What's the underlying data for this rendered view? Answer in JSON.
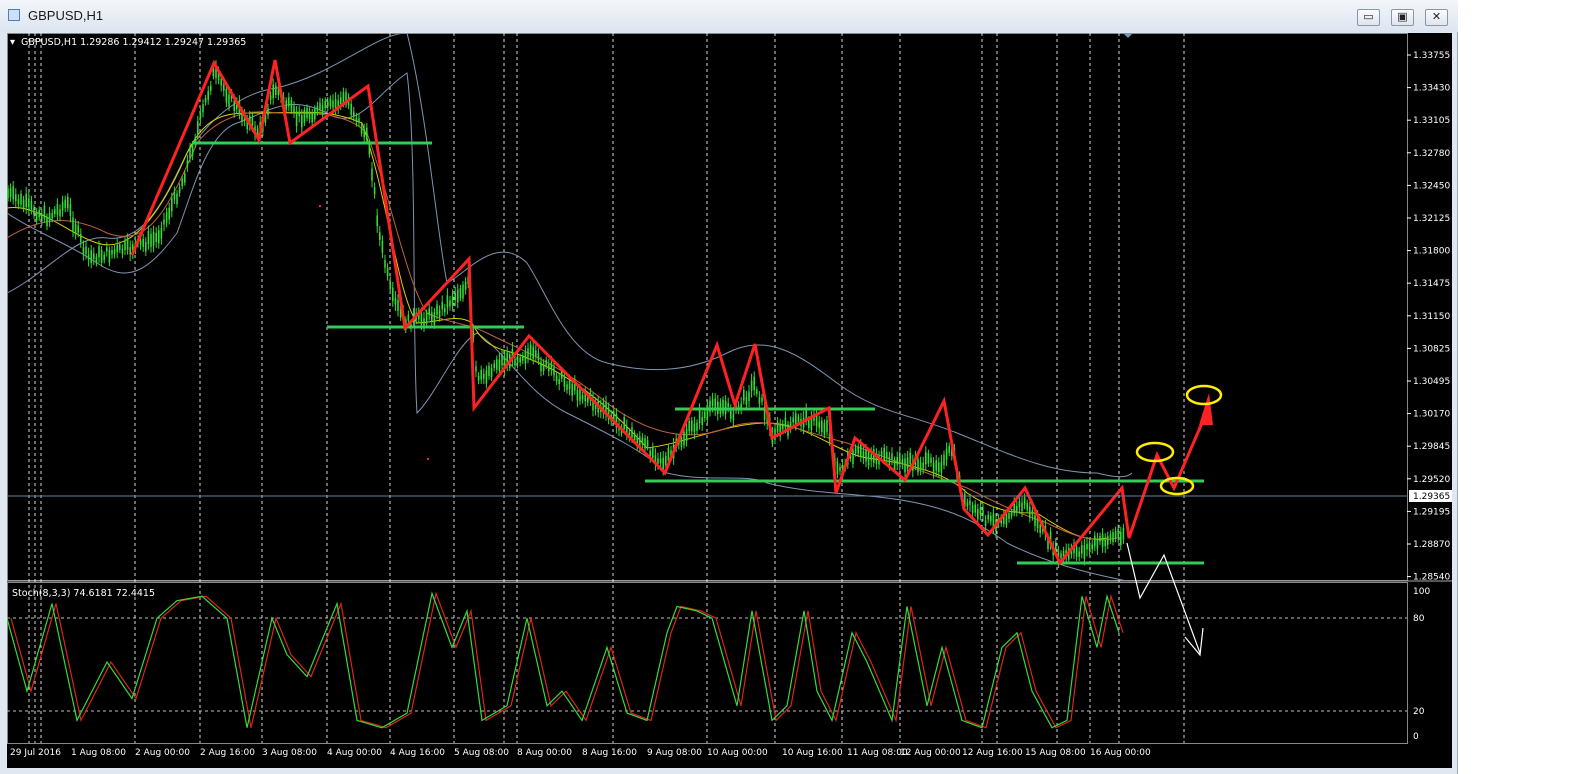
{
  "window": {
    "title": "GBPUSD,H1",
    "minimize_glyph": "▭",
    "restore_glyph": "▣",
    "close_glyph": "✕"
  },
  "chart_header": {
    "text": "GBPUSD,H1  1.29286 1.29412 1.29247 1.29365"
  },
  "price_axis": {
    "labels": [
      "1.33755",
      "1.33430",
      "1.33105",
      "1.32780",
      "1.32450",
      "1.32125",
      "1.31800",
      "1.31475",
      "1.31150",
      "1.30825",
      "1.30495",
      "1.30170",
      "1.29845",
      "1.29520",
      "1.29195",
      "1.28870",
      "1.28540"
    ],
    "current_price": "1.29365"
  },
  "indicator": {
    "header": "Stoch(8,3,3) 74.6181 72.4415",
    "levels": [
      "100",
      "80",
      "20",
      "0"
    ]
  },
  "time_axis": {
    "labels": [
      "29 Jul 2016",
      "1 Aug 08:00",
      "2 Aug 00:00",
      "2 Aug 16:00",
      "3 Aug 08:00",
      "4 Aug 00:00",
      "4 Aug 16:00",
      "5 Aug 08:00",
      "8 Aug 00:00",
      "8 Aug 16:00",
      "9 Aug 08:00",
      "10 Aug 00:00",
      "10 Aug 16:00",
      "11 Aug 08:00",
      "12 Aug 00:00",
      "12 Aug 16:00",
      "15 Aug 08:00",
      "16 Aug 00:00"
    ]
  },
  "colors": {
    "background": "#000000",
    "candles": "#33dd33",
    "zigzag": "#ff2222",
    "support_lines": "#33cc55",
    "bollinger": "#7f93b0",
    "ma_fast": "#e0d000",
    "ma_slow": "#c06040",
    "stoch_main": "#33dd33",
    "stoch_signal": "#dd2222",
    "markers": "#ffee00",
    "grid": "#ffffff"
  }
}
